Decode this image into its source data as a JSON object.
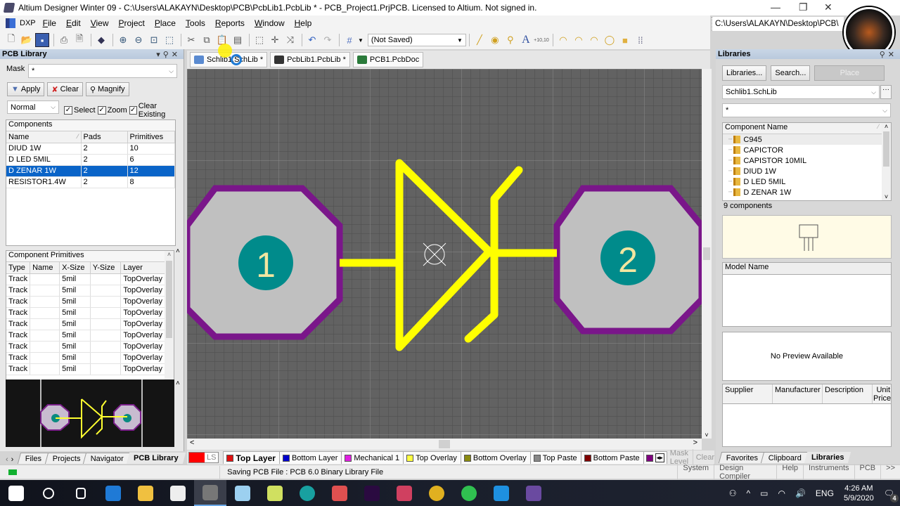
{
  "window": {
    "title": "Altium Designer Winter 09 - C:\\Users\\ALAKAYN\\Desktop\\PCB\\PcbLib1.PcbLib * - PCB_Project1.PrjPCB. Licensed to Altium. Not signed in.",
    "path_combo": "C:\\Users\\ALAKAYN\\Desktop\\PCB\\",
    "controls": {
      "minimize": "—",
      "restore": "❐",
      "close": "✕"
    }
  },
  "menu": {
    "dxp": "DXP",
    "items": [
      "File",
      "Edit",
      "View",
      "Project",
      "Place",
      "Tools",
      "Reports",
      "Window",
      "Help"
    ]
  },
  "toolbar": {
    "variant_combo": "(Not Saved)",
    "icons": [
      "new-icon",
      "open-icon",
      "save-icon",
      "print-icon",
      "print-preview-icon",
      "3d-view-icon",
      "zoom-in-icon",
      "zoom-out-icon",
      "zoom-fit-icon",
      "zoom-selected-icon",
      "cut-icon",
      "copy-icon",
      "paste-icon",
      "rubber-stamp-icon",
      "select-area-icon",
      "move-icon",
      "deselect-icon",
      "undo-icon",
      "redo-icon",
      "grid-icon"
    ],
    "place_icons": [
      "line-icon",
      "pad-icon",
      "via-icon",
      "string-icon",
      "coordinate-icon",
      "arc-center-icon",
      "arc-edge-icon",
      "arc-any-icon",
      "full-circle-icon",
      "fill-icon",
      "array-paste-icon"
    ],
    "coordinate_label": "+10,10"
  },
  "left_panel": {
    "title": "PCB Library",
    "mask_label": "Mask",
    "mask_value": "*",
    "buttons": {
      "apply": "Apply",
      "clear": "Clear",
      "magnify": "Magnify"
    },
    "mode_value": "Normal",
    "checkboxes": [
      {
        "label": "Select",
        "checked": true
      },
      {
        "label": "Zoom",
        "checked": true
      },
      {
        "label": "Clear Existing",
        "checked": true
      }
    ],
    "components": {
      "title": "Components",
      "columns": [
        "Name",
        "Pads",
        "Primitives"
      ],
      "rows": [
        {
          "name": "DIUD 1W",
          "pads": "2",
          "primitives": "10",
          "selected": false
        },
        {
          "name": "D LED 5MIL",
          "pads": "2",
          "primitives": "6",
          "selected": false
        },
        {
          "name": "D ZENAR 1W",
          "pads": "2",
          "primitives": "12",
          "selected": true
        },
        {
          "name": "RESISTOR1.4W",
          "pads": "2",
          "primitives": "8",
          "selected": false
        }
      ]
    },
    "primitives": {
      "title": "Component Primitives",
      "columns": [
        "Type",
        "Name",
        "X-Size",
        "Y-Size",
        "Layer"
      ],
      "rows": [
        {
          "type": "Track",
          "name": "",
          "xsize": "5mil",
          "ysize": "",
          "layer": "TopOverlay"
        },
        {
          "type": "Track",
          "name": "",
          "xsize": "5mil",
          "ysize": "",
          "layer": "TopOverlay"
        },
        {
          "type": "Track",
          "name": "",
          "xsize": "5mil",
          "ysize": "",
          "layer": "TopOverlay"
        },
        {
          "type": "Track",
          "name": "",
          "xsize": "5mil",
          "ysize": "",
          "layer": "TopOverlay"
        },
        {
          "type": "Track",
          "name": "",
          "xsize": "5mil",
          "ysize": "",
          "layer": "TopOverlay"
        },
        {
          "type": "Track",
          "name": "",
          "xsize": "5mil",
          "ysize": "",
          "layer": "TopOverlay"
        },
        {
          "type": "Track",
          "name": "",
          "xsize": "5mil",
          "ysize": "",
          "layer": "TopOverlay"
        },
        {
          "type": "Track",
          "name": "",
          "xsize": "5mil",
          "ysize": "",
          "layer": "TopOverlay"
        },
        {
          "type": "Track",
          "name": "",
          "xsize": "5mil",
          "ysize": "",
          "layer": "TopOverlay"
        }
      ]
    },
    "preview_pads": [
      "1",
      "2"
    ],
    "bottom_tabs": [
      {
        "label": "Files",
        "active": false
      },
      {
        "label": "Projects",
        "active": false
      },
      {
        "label": "Navigator",
        "active": false
      },
      {
        "label": "PCB Library",
        "active": true
      }
    ]
  },
  "doc_tabs": [
    {
      "label": "Schlib1.SchLib *",
      "icon": "schlib-icon"
    },
    {
      "label": "PcbLib1.PcbLib *",
      "icon": "pcblib-icon"
    },
    {
      "label": "PCB1.PcbDoc",
      "icon": "pcbdoc-icon"
    }
  ],
  "canvas": {
    "pads": [
      {
        "label": "1"
      },
      {
        "label": "2"
      }
    ],
    "colors": {
      "background": "#5f5f5f",
      "overlay": "#ffff00",
      "pad": "#c0c0c0",
      "pad_outline": "#7f0f8a",
      "hole": "#008b8b",
      "pad_label": "#f2e6a0"
    }
  },
  "layer_tabs": {
    "current_color_label": "LS",
    "tabs": [
      {
        "label": "Top Layer",
        "color": "#e01010",
        "active": true
      },
      {
        "label": "Bottom Layer",
        "color": "#0000cc",
        "active": false
      },
      {
        "label": "Mechanical 1",
        "color": "#e020e0",
        "active": false
      },
      {
        "label": "Top Overlay",
        "color": "#ffff40",
        "active": false
      },
      {
        "label": "Bottom Overlay",
        "color": "#8a8a10",
        "active": false
      },
      {
        "label": "Top Paste",
        "color": "#888888",
        "active": false
      },
      {
        "label": "Bottom Paste",
        "color": "#800000",
        "active": false
      }
    ],
    "mask_level": "Mask Level",
    "clear": "Clear"
  },
  "right_panel": {
    "title": "Libraries",
    "buttons": {
      "libraries": "Libraries...",
      "search": "Search...",
      "place": "Place"
    },
    "library_value": "Schlib1.SchLib",
    "filter_value": "*",
    "list_header": "Component Name",
    "components": [
      "C945",
      "CAPICTOR",
      "CAPISTOR 10MIL",
      "DIUD 1W",
      "D LED 5MIL",
      "D ZENAR 1W"
    ],
    "count": "9 components",
    "model_header": "Model Name",
    "no_preview": "No Preview Available",
    "supplier_columns": [
      "Supplier",
      "Manufacturer",
      "Description",
      "Unit Price"
    ],
    "bottom_tabs": [
      {
        "label": "Favorites",
        "active": false
      },
      {
        "label": "Clipboard",
        "active": false
      },
      {
        "label": "Libraries",
        "active": true
      }
    ]
  },
  "status": {
    "message": "Saving PCB File : PCB 6.0 Binary Library File",
    "right_buttons": [
      "System",
      "Design Compiler",
      "Help",
      "Instruments",
      "PCB",
      ">>"
    ]
  },
  "taskbar": {
    "apps": [
      "start-icon",
      "search-circle-icon",
      "task-view-icon",
      "edge-icon",
      "file-explorer-icon",
      "store-icon",
      "altium-icon",
      "app-cube-icon",
      "avr-icon",
      "arduino-icon",
      "camera-app-icon",
      "premiere-icon",
      "snipping-icon",
      "chrome-icon",
      "whatsapp-icon",
      "mail-icon",
      "video-app-icon"
    ],
    "language": "ENG",
    "time": "4:26 AM",
    "date": "5/9/2020",
    "notifications": "4"
  }
}
